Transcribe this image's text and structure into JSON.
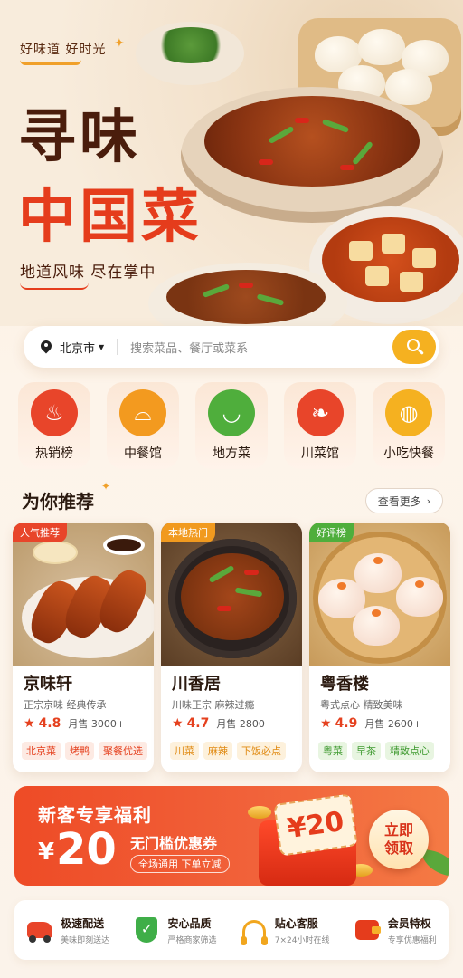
{
  "hero": {
    "tagline": "好味道 好时光",
    "title_line1": "寻味",
    "title_line2": "中国菜",
    "subtitle": "地道风味 尽在掌中"
  },
  "search": {
    "city": "北京市",
    "placeholder": "搜索菜品、餐厅或菜系",
    "button_icon": "search-icon"
  },
  "categories": [
    {
      "label": "热销榜",
      "icon": "hotpot-icon",
      "color": "#e8452a"
    },
    {
      "label": "中餐馆",
      "icon": "cloche-icon",
      "color": "#f39a1f"
    },
    {
      "label": "地方菜",
      "icon": "rice-bowl-icon",
      "color": "#4fae3c"
    },
    {
      "label": "川菜馆",
      "icon": "chili-icon",
      "color": "#e8452a"
    },
    {
      "label": "小吃快餐",
      "icon": "steamer-icon",
      "color": "#f5b120"
    }
  ],
  "recommend": {
    "title": "为你推荐",
    "more_label": "查看更多"
  },
  "restaurants": [
    {
      "badge": "人气推荐",
      "badge_color": "#e8452a",
      "name": "京味轩",
      "desc": "正宗京味  经典传承",
      "rating": "4.8",
      "sales": "月售 3000+",
      "tags": [
        "北京菜",
        "烤鸭",
        "聚餐优选"
      ],
      "tag_color": "#e5411f",
      "tag_bg": "#fdeae3"
    },
    {
      "badge": "本地热门",
      "badge_color": "#f19a1f",
      "name": "川香居",
      "desc": "川味正宗  麻辣过瘾",
      "rating": "4.7",
      "sales": "月售 2800+",
      "tags": [
        "川菜",
        "麻辣",
        "下饭必点"
      ],
      "tag_color": "#e08a12",
      "tag_bg": "#fdf1dc"
    },
    {
      "badge": "好评榜",
      "badge_color": "#4fae3c",
      "name": "粤香楼",
      "desc": "粤式点心  精致美味",
      "rating": "4.9",
      "sales": "月售 2600+",
      "tags": [
        "粤菜",
        "早茶",
        "精致点心"
      ],
      "tag_color": "#3f9a30",
      "tag_bg": "#e8f5e1"
    }
  ],
  "promo": {
    "title": "新客专享福利",
    "currency": "¥",
    "amount": "20",
    "label": "无门槛优惠券",
    "note": "全场通用  下单立减",
    "coupon_text": "¥20",
    "claim_line1": "立即",
    "claim_line2": "领取"
  },
  "services": [
    {
      "title": "极速配送",
      "sub": "美味即刻送达",
      "icon": "scooter-icon"
    },
    {
      "title": "安心品质",
      "sub": "严格商家筛选",
      "icon": "shield-check-icon"
    },
    {
      "title": "贴心客服",
      "sub": "7×24小时在线",
      "icon": "headset-icon"
    },
    {
      "title": "会员特权",
      "sub": "专享优惠福利",
      "icon": "wallet-icon"
    }
  ]
}
